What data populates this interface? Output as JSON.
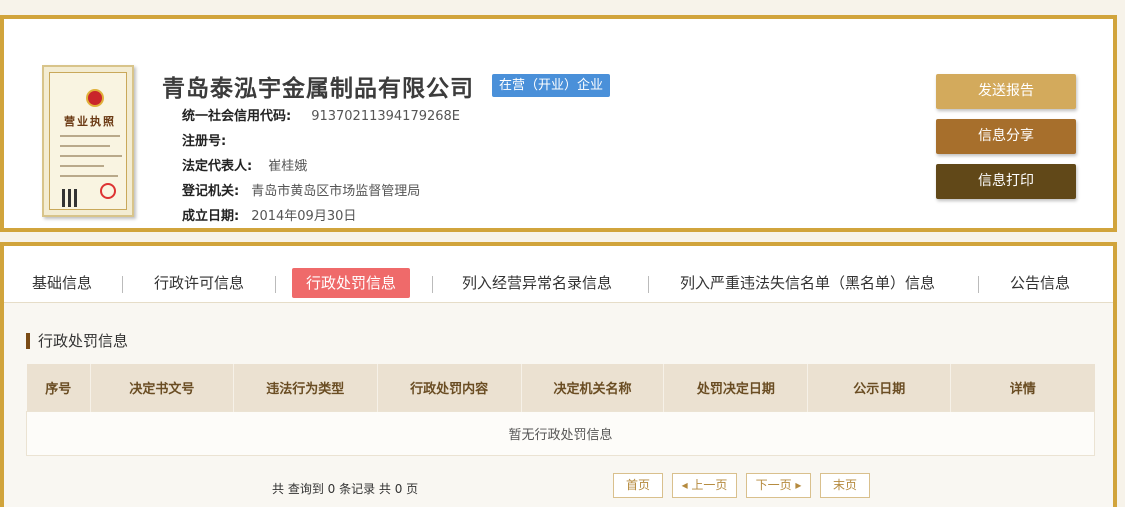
{
  "company": {
    "name": "青岛泰泓宇金属制品有限公司",
    "status": "在营（开业）企业",
    "license_title": "营业执照",
    "fields": [
      {
        "label": "统一社会信用代码:",
        "value": "91370211394179268E"
      },
      {
        "label": "注册号:",
        "value": ""
      },
      {
        "label": "法定代表人:",
        "value": "崔桂娥"
      },
      {
        "label": "登记机关:",
        "value": "青岛市黄岛区市场监督管理局"
      },
      {
        "label": "成立日期:",
        "value": "2014年09月30日"
      }
    ]
  },
  "actions": {
    "report": "发送报告",
    "share": "信息分享",
    "print": "信息打印"
  },
  "tabs": [
    {
      "label": "基础信息",
      "active": false
    },
    {
      "label": "行政许可信息",
      "active": false
    },
    {
      "label": "行政处罚信息",
      "active": true
    },
    {
      "label": "列入经营异常名录信息",
      "active": false
    },
    {
      "label": "列入严重违法失信名单（黑名单）信息",
      "active": false
    },
    {
      "label": "公告信息",
      "active": false
    }
  ],
  "section": {
    "title": "行政处罚信息",
    "columns": [
      "序号",
      "决定书文号",
      "违法行为类型",
      "行政处罚内容",
      "决定机关名称",
      "处罚决定日期",
      "公示日期",
      "详情"
    ],
    "empty_text": "暂无行政处罚信息"
  },
  "pagination": {
    "summary": "共 查询到 0 条记录 共 0 页",
    "first": "首页",
    "prev": "上一页",
    "next": "下一页",
    "last": "末页"
  },
  "colors": {
    "border": "#d1a43c",
    "status_badge": "#4a90d9",
    "active_tab": "#ef6a6a"
  }
}
